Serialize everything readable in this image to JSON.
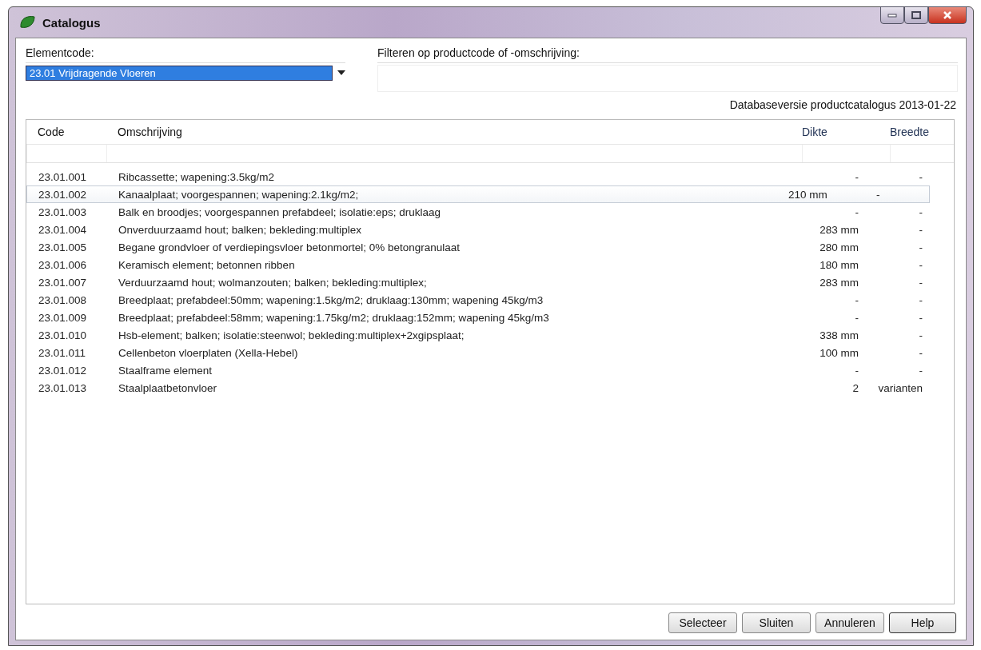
{
  "window": {
    "title": "Catalogus"
  },
  "elementcode": {
    "label": "Elementcode:",
    "value": "23.01 Vrijdragende Vloeren"
  },
  "filter": {
    "label": "Filteren op productcode of -omschrijving:"
  },
  "database_version": "Databaseversie productcatalogus 2013-01-22",
  "table": {
    "columns": [
      "Code",
      "Omschrijving",
      "Dikte",
      "Breedte"
    ],
    "rows": [
      {
        "code": "23.01.001",
        "description": "Ribcassette; wapening:3.5kg/m2",
        "dikte": "-",
        "breedte": "-",
        "selected": false
      },
      {
        "code": "23.01.002",
        "description": "Kanaalplaat; voorgespannen; wapening:2.1kg/m2;",
        "dikte": "210 mm",
        "breedte": "-",
        "selected": true
      },
      {
        "code": "23.01.003",
        "description": "Balk en broodjes; voorgespannen prefabdeel; isolatie:eps; druklaag",
        "dikte": "-",
        "breedte": "-",
        "selected": false
      },
      {
        "code": "23.01.004",
        "description": "Onverduurzaamd hout; balken; bekleding:multiplex",
        "dikte": "283 mm",
        "breedte": "-",
        "selected": false
      },
      {
        "code": "23.01.005",
        "description": "Begane grondvloer of verdiepingsvloer betonmortel; 0% betongranulaat",
        "dikte": "280 mm",
        "breedte": "-",
        "selected": false
      },
      {
        "code": "23.01.006",
        "description": "Keramisch element; betonnen ribben",
        "dikte": "180 mm",
        "breedte": "-",
        "selected": false
      },
      {
        "code": "23.01.007",
        "description": "Verduurzaamd hout; wolmanzouten; balken; bekleding:multiplex;",
        "dikte": "283 mm",
        "breedte": "-",
        "selected": false
      },
      {
        "code": "23.01.008",
        "description": "Breedplaat; prefabdeel:50mm; wapening:1.5kg/m2; druklaag:130mm; wapening 45kg/m3",
        "dikte": "-",
        "breedte": "-",
        "selected": false
      },
      {
        "code": "23.01.009",
        "description": "Breedplaat; prefabdeel:58mm; wapening:1.75kg/m2; druklaag:152mm; wapening 45kg/m3",
        "dikte": "-",
        "breedte": "-",
        "selected": false
      },
      {
        "code": "23.01.010",
        "description": "Hsb-element; balken; isolatie:steenwol; bekleding:multiplex+2xgipsplaat;",
        "dikte": "338 mm",
        "breedte": "-",
        "selected": false
      },
      {
        "code": "23.01.011",
        "description": "Cellenbeton vloerplaten (Xella-Hebel)",
        "dikte": "100 mm",
        "breedte": "-",
        "selected": false
      },
      {
        "code": "23.01.012",
        "description": "Staalframe element",
        "dikte": "-",
        "breedte": "-",
        "selected": false
      },
      {
        "code": "23.01.013",
        "description": "Staalplaatbetonvloer",
        "dikte": "2",
        "breedte": "varianten",
        "selected": false
      }
    ]
  },
  "buttons": [
    "Selecteer",
    "Sluiten",
    "Annuleren",
    "Help"
  ]
}
